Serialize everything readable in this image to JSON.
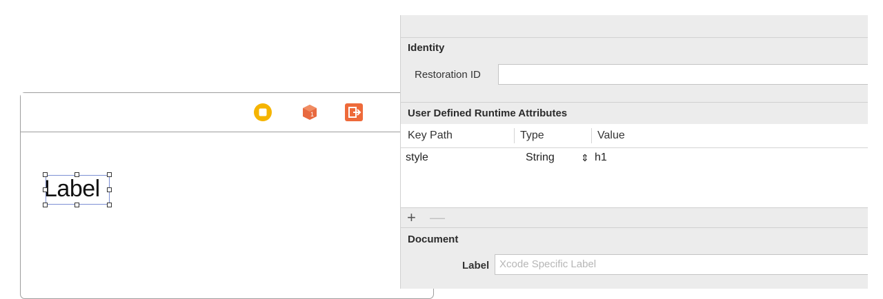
{
  "canvas": {
    "label_text": "Label",
    "dock_icons": [
      "view-controller-icon",
      "first-responder-icon",
      "exit-icon"
    ],
    "colors": {
      "view_controller": "#f5b400",
      "first_responder": "#e8693f",
      "exit": "#ee6a3a"
    }
  },
  "inspector": {
    "identity": {
      "title": "Identity",
      "restoration_id_label": "Restoration ID",
      "restoration_id_value": ""
    },
    "runtime_attributes": {
      "title": "User Defined Runtime Attributes",
      "columns": [
        "Key Path",
        "Type",
        "Value"
      ],
      "rows": [
        {
          "key_path": "style",
          "type": "String",
          "value": "h1"
        }
      ],
      "add_label": "+",
      "remove_label": "—"
    },
    "document": {
      "title": "Document",
      "label_label": "Label",
      "label_placeholder": "Xcode Specific Label"
    }
  }
}
